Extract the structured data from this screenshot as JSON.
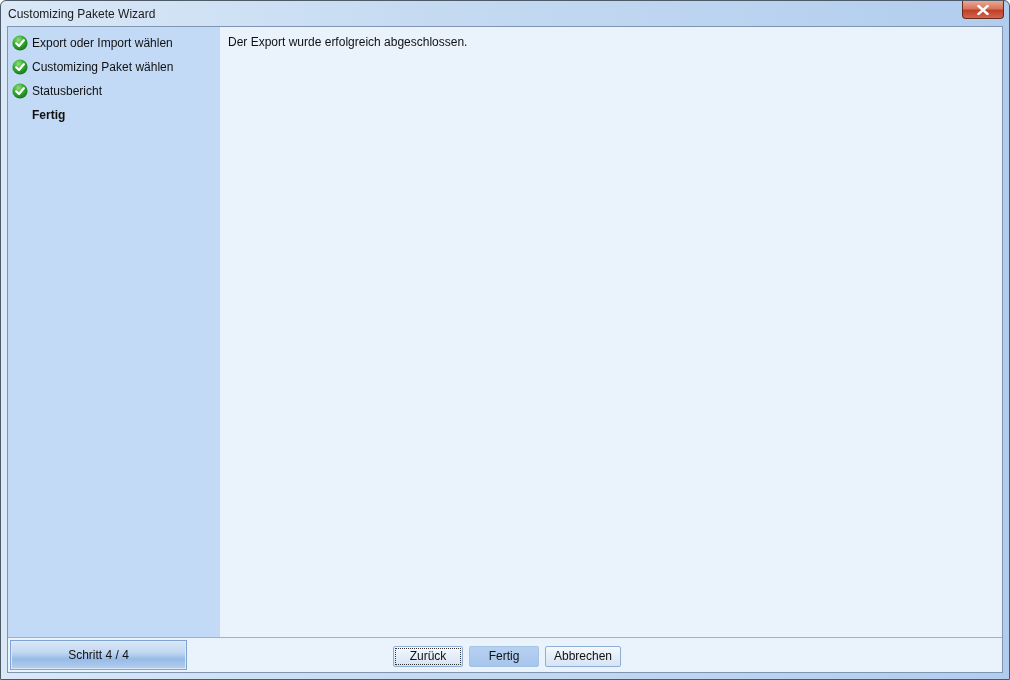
{
  "window": {
    "title": "Customizing Pakete Wizard"
  },
  "steps": [
    {
      "label": "Export oder Import wählen",
      "done": true,
      "selected": false
    },
    {
      "label": "Customizing Paket wählen",
      "done": true,
      "selected": false
    },
    {
      "label": "Statusbericht",
      "done": true,
      "selected": false
    },
    {
      "label": "Fertig",
      "done": false,
      "selected": true
    }
  ],
  "message": "Der Export wurde erfolgreich abgeschlossen.",
  "step_counter": "Schritt 4 / 4",
  "buttons": [
    {
      "label": "Zurück",
      "focused": true,
      "highlighted": false
    },
    {
      "label": "Fertig",
      "focused": false,
      "highlighted": true
    },
    {
      "label": "Abbrechen",
      "focused": false,
      "highlighted": false
    }
  ]
}
